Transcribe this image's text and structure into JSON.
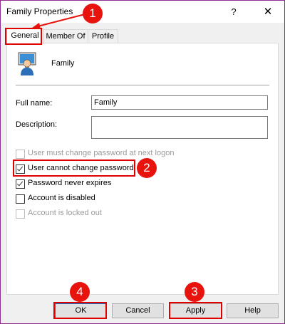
{
  "window": {
    "title": "Family Properties",
    "help_glyph": "?",
    "close_glyph": "✕"
  },
  "tabs": [
    {
      "label": "General",
      "active": true
    },
    {
      "label": "Member Of",
      "active": false
    },
    {
      "label": "Profile",
      "active": false
    }
  ],
  "general": {
    "user_icon": "user-account-icon",
    "user_name": "Family",
    "full_name_label": "Full name:",
    "full_name_value": "Family",
    "description_label": "Description:",
    "description_value": ""
  },
  "checkboxes": [
    {
      "label": "User must change password at next logon",
      "checked": false,
      "enabled": false
    },
    {
      "label": "User cannot change password",
      "checked": true,
      "enabled": true
    },
    {
      "label": "Password never expires",
      "checked": true,
      "enabled": true
    },
    {
      "label": "Account is disabled",
      "checked": false,
      "enabled": true
    },
    {
      "label": "Account is locked out",
      "checked": false,
      "enabled": false
    }
  ],
  "buttons": {
    "ok": "OK",
    "cancel": "Cancel",
    "apply": "Apply",
    "help": "Help"
  },
  "annotations": {
    "badge_1": "1",
    "badge_2": "2",
    "badge_3": "3",
    "badge_4": "4"
  },
  "colors": {
    "highlight": "#e00000",
    "badge": "#e8130d",
    "window_border": "#8c2f90",
    "default_button_border": "#0078d7"
  }
}
